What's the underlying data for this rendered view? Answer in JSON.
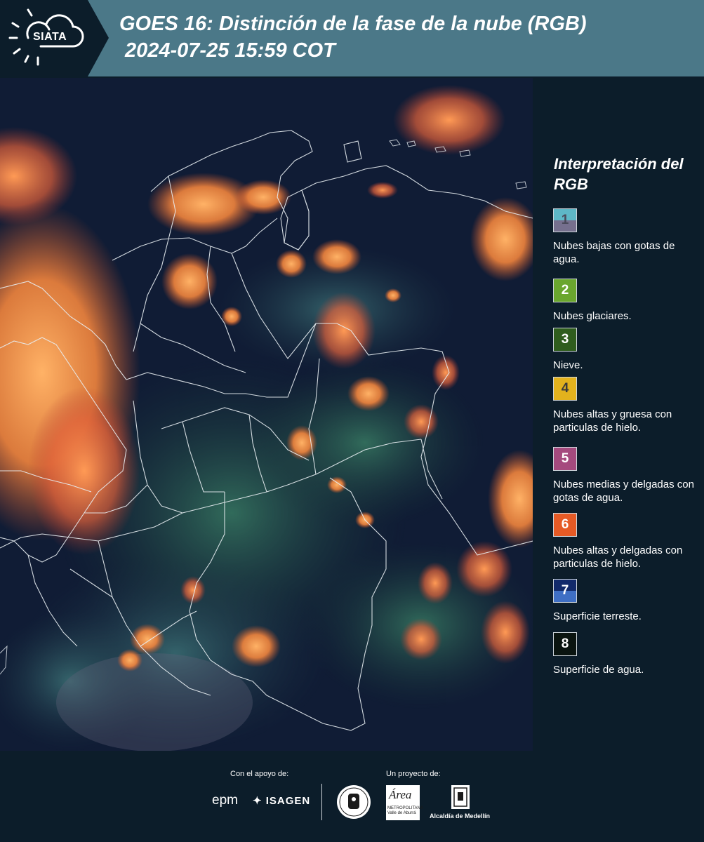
{
  "header": {
    "logo_text": "SIATA",
    "title": "GOES 16: Distinción de la fase de la nube (RGB)",
    "timestamp": "2024-07-25 15:59 COT",
    "bg_color": "#4b7888"
  },
  "legend": {
    "title": "Interpretación del RGB",
    "items": [
      {
        "num": "1",
        "text": "Nubes bajas con gotas de agua.",
        "color_top": "#5eb8c7",
        "color_bottom": "#76708e",
        "num_color": "#4a4a5a"
      },
      {
        "num": "2",
        "text": "Nubes glaciares.",
        "color_top": "#6aa62e",
        "color_bottom": "#6aa62e",
        "num_color": "#ffffff"
      },
      {
        "num": "3",
        "text": "Nieve.",
        "color_top": "#2f5d1d",
        "color_bottom": "#2f5d1d",
        "num_color": "#ffffff"
      },
      {
        "num": "4",
        "text": "Nubes altas y gruesa con particulas de hielo.",
        "color_top": "#e3b21d",
        "color_bottom": "#e3b21d",
        "num_color": "#3a3a3a"
      },
      {
        "num": "5",
        "text": "Nubes medias y delgadas con gotas de agua.",
        "color_top": "#a54a7e",
        "color_bottom": "#a54a7e",
        "num_color": "#ffffff"
      },
      {
        "num": "6",
        "text": "Nubes altas y delgadas con particulas de hielo.",
        "color_top": "#e65a25",
        "color_bottom": "#e65a25",
        "num_color": "#ffffff"
      },
      {
        "num": "7",
        "text": "Superficie terreste.",
        "color_top": "#122a6b",
        "color_bottom": "#3f6fc4",
        "num_color": "#ffffff"
      },
      {
        "num": "8",
        "text": "Superficie de agua.",
        "color_top": "#0a1410",
        "color_bottom": "#0a1410",
        "num_color": "#ffffff"
      }
    ]
  },
  "footer": {
    "support_label": "Con el apoyo de:",
    "project_label": "Un proyecto de:",
    "epm": "epm",
    "isagen": "ISAGEN",
    "area_name": "Área",
    "area_sub": "METROPOLITANA Valle de Aburrá",
    "alcaldia": "Alcaldía de Medellín"
  }
}
